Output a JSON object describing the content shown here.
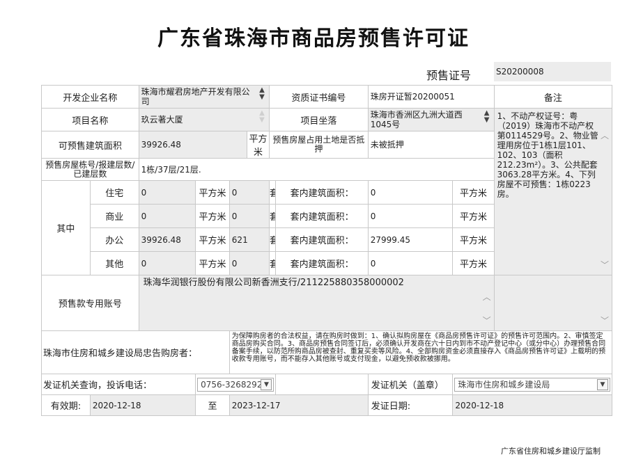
{
  "title": "广东省珠海市商品房预售许可证",
  "permit": {
    "label": "预售证号",
    "value": "S20200008"
  },
  "row1": {
    "developer_label": "开发企业名称",
    "developer_value": "珠海市耀君房地产开发有限公司",
    "cert_label": "资质证书编号",
    "cert_value": "珠房开证暂20200051",
    "remarks_label": "备注"
  },
  "row2": {
    "project_label": "项目名称",
    "project_value": "玖云著大厦",
    "location_label": "项目坐落",
    "location_value": "珠海市香洲区九洲大道西1045号"
  },
  "row3": {
    "area_label": "可预售建筑面积",
    "area_value": "39926.48",
    "unit": "平方米",
    "land_label": "预售房屋占用土地是否抵押",
    "land_value": "未被抵押"
  },
  "row4": {
    "floors_label": "预售房屋栋号/报建层数/已建层数",
    "floors_value": "1栋/37层/21层."
  },
  "breakdown": {
    "group_label": "其中",
    "unit_area": "平方米",
    "unit_sets": "套",
    "inner_label": "套内建筑面积：",
    "rows": [
      {
        "type": "住宅",
        "area": "0",
        "sets": "0",
        "inner": "0"
      },
      {
        "type": "商业",
        "area": "0",
        "sets": "0",
        "inner": "0"
      },
      {
        "type": "办公",
        "area": "39926.48",
        "sets": "621",
        "inner": "27999.45"
      },
      {
        "type": "其他",
        "area": "0",
        "sets": "0",
        "inner": "0"
      }
    ]
  },
  "remarks": "1、不动产权证号：粤（2019）珠海市不动产权第0114529号。2、物业管理用房位于1栋1层101、102、103（面积212.23m²）。3、公共配套3063.28平方米。4、下列房屋不可预售：1栋0223房。",
  "account": {
    "label": "预售款专用账号",
    "value": "珠海华润银行股份有限公司新香洲支行/211225880358000002"
  },
  "notice": {
    "label": "珠海市住房和城乡建设局忠告购房者：",
    "text": "为保障购房者的合法权益，请在购房时做到：1、确认拟购房屋在《商品房预售许可证》的预售许可范围内。2、审慎签定商品房购买合同。3、商品房预售合同签订后，必须确认开发商在六十日内到市不动产登记中心（或分中心）办理预售合同备案手续，以防范所购商品房被查封、重复买卖等风险。4、全部购房资金必须直接存入《商品房预售许可证》上载明的预收款专用账号，而不能存入其他账号或支付现金，以避免预收款被挪用。"
  },
  "contact": {
    "label": "发证机关查询，投诉电话：",
    "phone": "0756-3268292",
    "issuer_label": "发证机关（盖章）",
    "issuer_value": "珠海市住房和城乡建设局"
  },
  "validity": {
    "label": "有效期:",
    "from": "2020-12-18",
    "to_label": "至",
    "to": "2023-12-17",
    "issue_label": "发证日期:",
    "issue_date": "2020-12-18"
  },
  "footer": "广东省住房和城乡建设厅监制"
}
